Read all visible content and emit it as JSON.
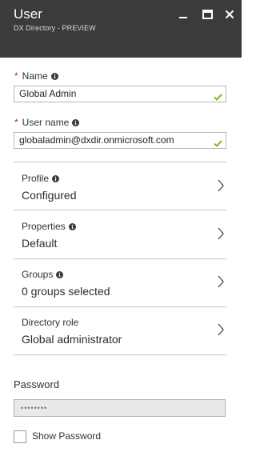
{
  "header": {
    "title": "User",
    "subtitle": "DX Directory - PREVIEW"
  },
  "name_field": {
    "required_marker": "*",
    "label": "Name",
    "value": "Global Admin"
  },
  "username_field": {
    "required_marker": "*",
    "label": "User name",
    "value": "globaladmin@dxdir.onmicrosoft.com"
  },
  "rows": [
    {
      "label": "Profile",
      "value": "Configured",
      "has_info": true
    },
    {
      "label": "Properties",
      "value": "Default",
      "has_info": true
    },
    {
      "label": "Groups",
      "value": "0 groups selected",
      "has_info": true
    },
    {
      "label": "Directory role",
      "value": "Global administrator",
      "has_info": false
    }
  ],
  "password": {
    "label": "Password",
    "value": "••••••••"
  },
  "show_password": {
    "label": "Show Password",
    "checked": false
  },
  "colors": {
    "header_bg": "#3b3b3b",
    "required": "#c6292f",
    "valid_check": "#6bb700"
  },
  "icons": [
    "minimize-icon",
    "maximize-icon",
    "close-icon",
    "info-icon",
    "checkmark-icon",
    "chevron-right-icon"
  ]
}
